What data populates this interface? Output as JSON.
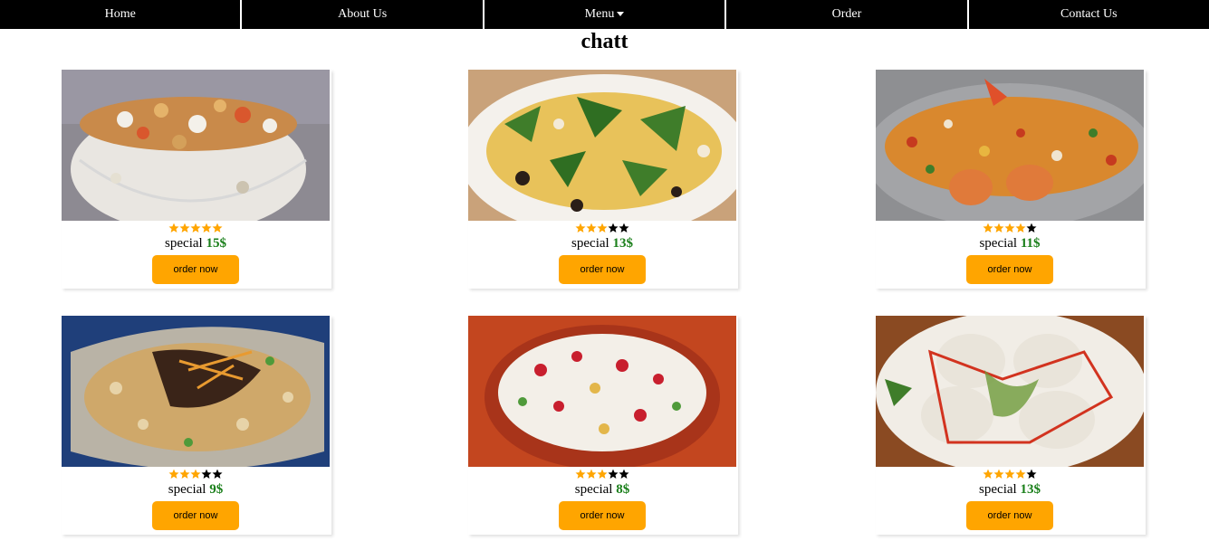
{
  "nav": {
    "items": [
      {
        "label": "Home"
      },
      {
        "label": "About Us"
      },
      {
        "label": "Menu"
      },
      {
        "label": "Order"
      },
      {
        "label": "Contact Us"
      }
    ]
  },
  "page": {
    "title": "chatt"
  },
  "colors": {
    "accent": "#ffa500",
    "price": "#1a7f1a",
    "nav_bg": "#000000",
    "star_filled": "#ffa500",
    "star_empty": "#000000"
  },
  "cards": [
    {
      "rating": 5,
      "special_label": "special",
      "price": "15$",
      "button_label": "order now",
      "image": "papdi-chaat-bowl"
    },
    {
      "rating": 3,
      "special_label": "special",
      "price": "13$",
      "button_label": "order now",
      "image": "chaat-plate-coriander"
    },
    {
      "rating": 4,
      "special_label": "special",
      "price": "11$",
      "button_label": "order now",
      "image": "chana-chaat-tray"
    },
    {
      "rating": 3,
      "special_label": "special",
      "price": "9$",
      "button_label": "order now",
      "image": "aloo-chaat-sev"
    },
    {
      "rating": 3,
      "special_label": "special",
      "price": "8$",
      "button_label": "order now",
      "image": "dahi-papdi-pomegranate"
    },
    {
      "rating": 4,
      "special_label": "special",
      "price": "13$",
      "button_label": "order now",
      "image": "dahi-vada"
    }
  ]
}
